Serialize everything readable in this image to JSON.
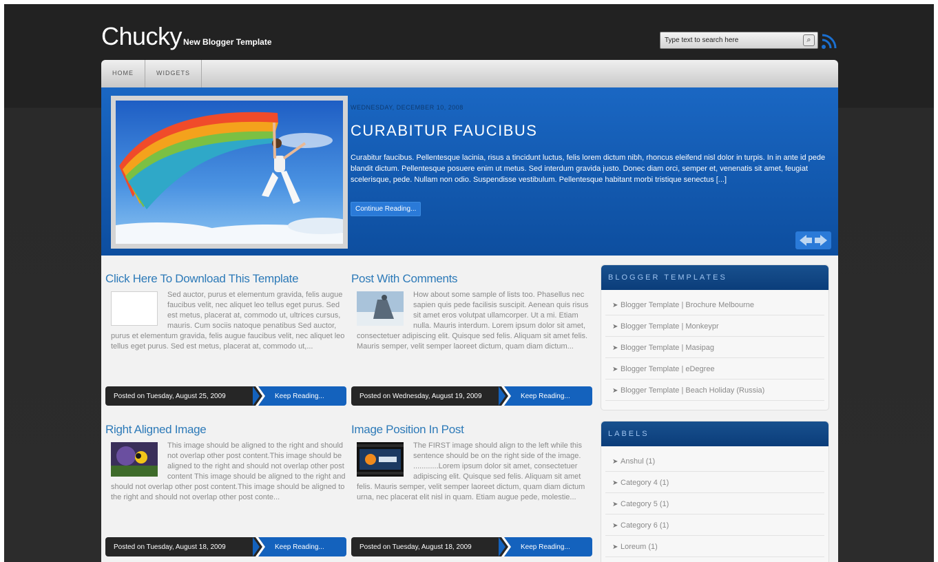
{
  "header": {
    "logo_title": "Chucky",
    "logo_subtitle": "New Blogger Template",
    "search_placeholder": "Type text to search here"
  },
  "nav": {
    "items": [
      {
        "label": "HOME"
      },
      {
        "label": "WIDGETS"
      }
    ]
  },
  "featured": {
    "date": "WEDNESDAY, DECEMBER 10, 2008",
    "title": "CURABITUR FAUCIBUS",
    "excerpt": "Curabitur faucibus. Pellentesque lacinia, risus a tincidunt luctus, felis lorem dictum nibh, rhoncus eleifend nisl dolor in turpis. In in ante id pede blandit dictum. Pellentesque posuere enim ut metus. Sed interdum gravida justo. Donec diam orci, semper et, venenatis sit amet, feugiat scelerisque, pede. Nullam non odio. Suspendisse vestibulum. Pellentesque habitant morbi tristique senectus [...]",
    "more_label": "Continue Reading..."
  },
  "posts": [
    {
      "title": "Click Here To Download This Template",
      "excerpt": "Sed auctor, purus et elementum gravida, felis augue faucibus velit, nec aliquet leo tellus eget purus. Sed est metus, placerat at, commodo ut, ultrices cursus, mauris. Cum sociis natoque penatibus Sed auctor, purus et elementum gravida, felis augue faucibus velit, nec aliquet leo tellus eget purus. Sed est metus, placerat at, commodo ut,...",
      "posted": "Posted on Tuesday, August 25, 2009",
      "more": "Keep Reading..."
    },
    {
      "title": "Post With Comments",
      "excerpt": "How about some sample of lists too. Phasellus nec sapien quis pede facilisis suscipit. Aenean quis risus sit amet eros volutpat ullamcorper. Ut a mi. Etiam nulla. Mauris interdum. Lorem ipsum dolor sit amet, consectetuer adipiscing elit. Quisque sed felis. Aliquam sit amet felis. Mauris semper, velit semper laoreet dictum, quam diam dictum...",
      "posted": "Posted on Wednesday, August 19, 2009",
      "more": "Keep Reading..."
    },
    {
      "title": "Right Aligned Image",
      "excerpt": "This image should be aligned to the right and should not overlap other post content.This image should be aligned to the right and should not overlap other post content This image should be aligned to the right and should not overlap other post content.This image should be aligned to the right and should not overlap other post conte...",
      "posted": "Posted on Tuesday, August 18, 2009",
      "more": "Keep Reading..."
    },
    {
      "title": "Image Position In Post",
      "excerpt": "The FIRST image should align to the left while this sentence should be on the right side of the image. ............Lorem ipsum dolor sit amet, consectetuer adipiscing elit. Quisque sed felis. Aliquam sit amet felis. Mauris semper, velit semper laoreet dictum, quam diam dictum urna, nec placerat elit nisl in quam. Etiam augue pede, molestie...",
      "posted": "Posted on Tuesday, August 18, 2009",
      "more": "Keep Reading..."
    }
  ],
  "sidebar": {
    "templates": {
      "heading": "BLOGGER TEMPLATES",
      "items": [
        {
          "label": "Blogger Template | Brochure Melbourne"
        },
        {
          "label": "Blogger Template | Monkeypr"
        },
        {
          "label": "Blogger Template | Masipag"
        },
        {
          "label": "Blogger Template | eDegree"
        },
        {
          "label": "Blogger Template | Beach Holiday (Russia)"
        }
      ]
    },
    "labels": {
      "heading": "LABELS",
      "items": [
        {
          "label": "Anshul (1)"
        },
        {
          "label": "Category 4 (1)"
        },
        {
          "label": "Category 5 (1)"
        },
        {
          "label": "Category 6 (1)"
        },
        {
          "label": "Loreum (1)"
        }
      ]
    }
  }
}
